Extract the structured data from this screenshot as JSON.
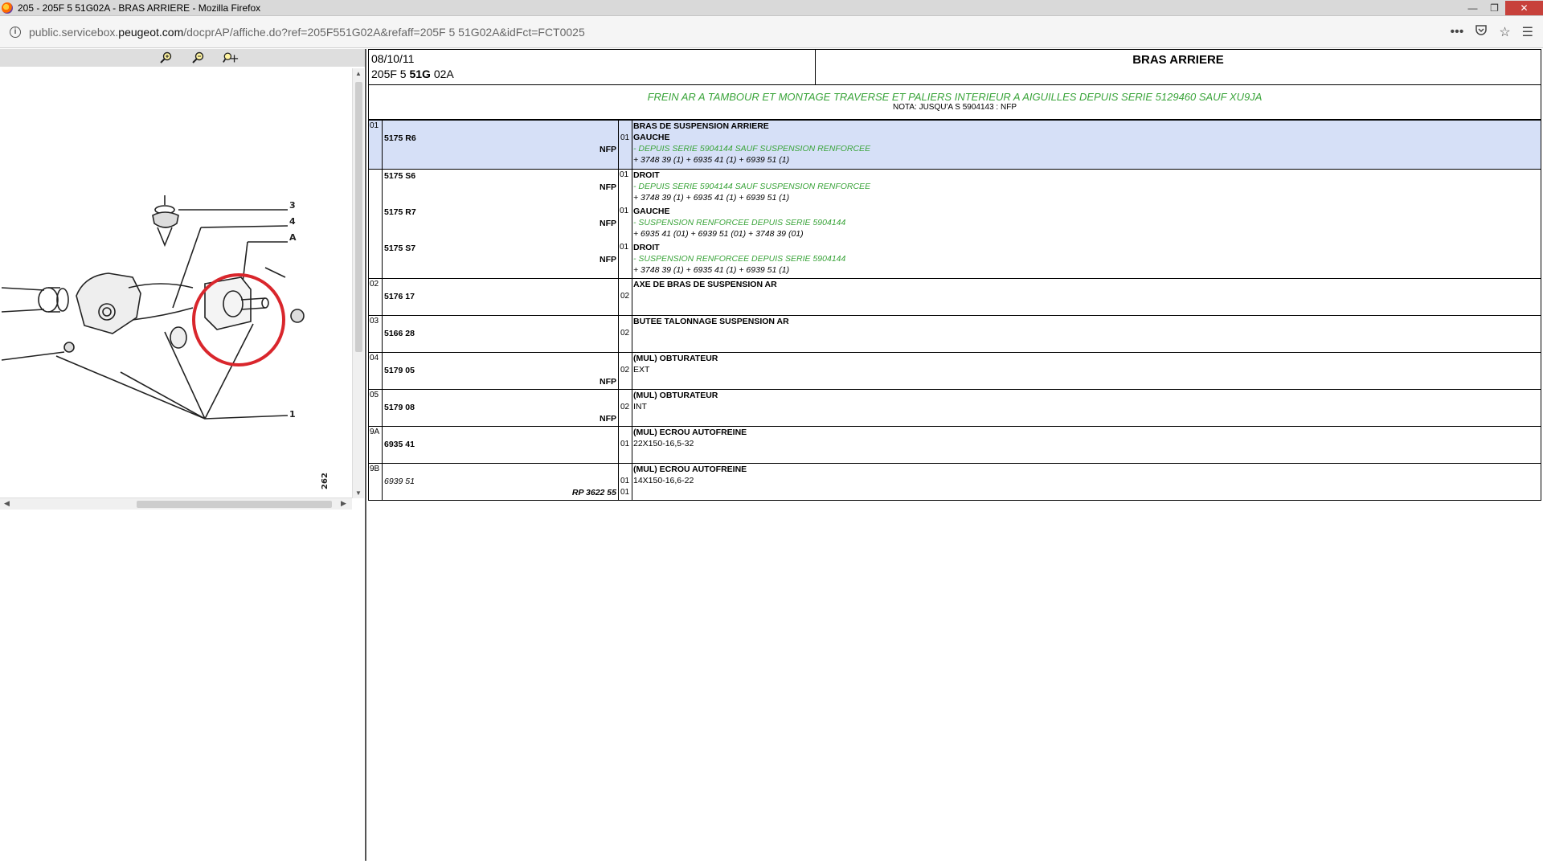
{
  "window": {
    "title": "205 - 205F 5 51G02A - BRAS ARRIERE - Mozilla Firefox",
    "minimize": "—",
    "maximize": "❐",
    "close": "✕"
  },
  "address": {
    "url_prefix": "public.servicebox.",
    "url_domain": "peugeot.com",
    "url_suffix": "/docprAP/affiche.do?ref=205F551G02A&refaff=205F 5 51G02A&idFct=FCT0025"
  },
  "header": {
    "date": "08/10/11",
    "code_pre": "205F 5 ",
    "code_bold": "51G",
    "code_post": " 02A",
    "title": "BRAS ARRIERE"
  },
  "subheader": {
    "description": "FREIN AR A TAMBOUR ET MONTAGE TRAVERSE ET PALIERS INTERIEUR A AIGUILLES DEPUIS SERIE 5129460 SAUF XU9JA",
    "nota": "NOTA: JUSQU'A S 5904143 : NFP"
  },
  "drawing": {
    "labels": [
      "3",
      "4",
      "A",
      "1"
    ],
    "page_code": "262"
  },
  "rows": [
    {
      "item": "01",
      "selected": true,
      "header": "BRAS DE SUSPENSION ARRIERE",
      "parts": [
        {
          "ref": "5175 R6",
          "flag": "NFP",
          "qty": "01",
          "side": "GAUCHE",
          "note": "- DEPUIS SERIE 5904144 SAUF SUSPENSION RENFORCEE",
          "refs": "+ 3748 39 (1) + 6935 41 (1) + 6939 51 (1)"
        }
      ]
    },
    {
      "item": "",
      "selected": false,
      "parts": [
        {
          "ref": "5175 S6",
          "flag": "NFP",
          "qty": "01",
          "side": "DROIT",
          "note": "- DEPUIS SERIE 5904144 SAUF SUSPENSION RENFORCEE",
          "refs": "+ 3748 39 (1) + 6935 41 (1) + 6939 51 (1)"
        },
        {
          "ref": "5175 R7",
          "flag": "NFP",
          "qty": "01",
          "side": "GAUCHE",
          "note": "- SUSPENSION RENFORCEE DEPUIS SERIE 5904144",
          "refs": "+ 6935 41 (01) + 6939 51 (01) + 3748 39 (01)"
        },
        {
          "ref": "5175 S7",
          "flag": "NFP",
          "qty": "01",
          "side": "DROIT",
          "note": "- SUSPENSION RENFORCEE DEPUIS SERIE 5904144",
          "refs": "+ 3748 39 (1) + 6935 41 (1) + 6939 51 (1)"
        }
      ]
    },
    {
      "item": "02",
      "ref": "5176 17",
      "flag": "",
      "qty": "02",
      "name": "AXE DE BRAS DE SUSPENSION AR",
      "detail": ""
    },
    {
      "item": "03",
      "ref": "5166 28",
      "flag": "",
      "qty": "02",
      "name": "BUTEE TALONNAGE SUSPENSION AR",
      "detail": ""
    },
    {
      "item": "04",
      "ref": "5179 05",
      "flag": "NFP",
      "qty": "02",
      "name": "(MUL) OBTURATEUR",
      "detail": "EXT"
    },
    {
      "item": "05",
      "ref": "5179 08",
      "flag": "NFP",
      "qty": "02",
      "name": "(MUL) OBTURATEUR",
      "detail": "INT"
    },
    {
      "item": "9A",
      "ref": "6935 41",
      "flag": "",
      "qty": "01",
      "name": "(MUL) ECROU AUTOFREINE",
      "detail": "22X150-16,5-32"
    },
    {
      "item": "9B",
      "ref": "6939 51",
      "flag": "RP 3622 55",
      "qty": "01",
      "qty2": "01",
      "name": "(MUL) ECROU AUTOFREINE",
      "detail": "14X150-16,6-22"
    }
  ],
  "colors": {
    "selected_row": "#d6e0f7",
    "green_text": "#3aa43a",
    "highlight_circle": "#d9262c"
  }
}
